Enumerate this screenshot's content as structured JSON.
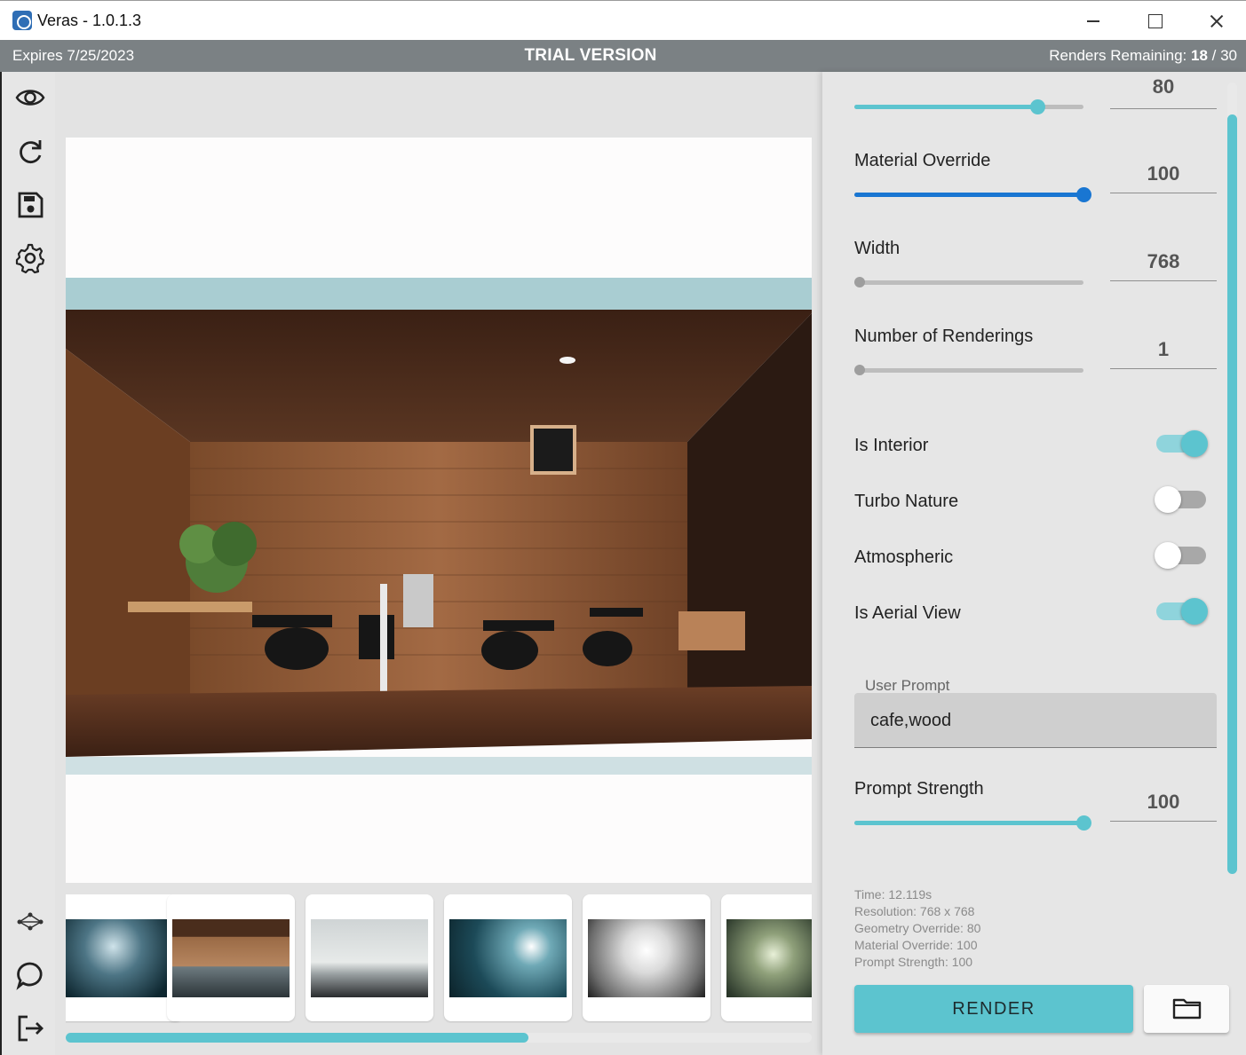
{
  "window": {
    "title": "Veras - 1.0.1.3"
  },
  "banner": {
    "expires": "Expires 7/25/2023",
    "trial": "TRIAL VERSION",
    "renders_label": "Renders Remaining:",
    "renders_used": "18",
    "renders_total": "/ 30"
  },
  "sidebar": {
    "top_icons": [
      "eye-icon",
      "refresh-icon",
      "save-icon",
      "gear-icon"
    ],
    "bottom_icons": [
      "network-icon",
      "chat-icon",
      "logout-icon"
    ]
  },
  "viewer": {
    "image_description_visible": false,
    "thumbnails_count": 6,
    "scroll_fraction": 0.62
  },
  "panel": {
    "geometry_override": {
      "value": "80",
      "fraction": 0.8
    },
    "material_override": {
      "label": "Material Override",
      "value": "100",
      "fraction": 1.0
    },
    "width": {
      "label": "Width",
      "value": "768",
      "fraction": 0.0
    },
    "num_renderings": {
      "label": "Number of Renderings",
      "value": "1",
      "fraction": 0.0
    },
    "toggles": [
      {
        "label": "Is Interior",
        "on": true
      },
      {
        "label": "Turbo Nature",
        "on": false
      },
      {
        "label": "Atmospheric",
        "on": false
      },
      {
        "label": "Is Aerial View",
        "on": true
      }
    ],
    "user_prompt": {
      "label": "User Prompt",
      "value": "cafe,wood"
    },
    "prompt_strength": {
      "label": "Prompt Strength",
      "value": "100",
      "fraction": 1.0
    },
    "stats": {
      "time": "Time: 12.119s",
      "resolution": "Resolution: 768 x 768",
      "geometry": "Geometry Override: 80",
      "material": "Material Override: 100",
      "prompt": "Prompt Strength: 100"
    },
    "render_label": "RENDER"
  },
  "colors": {
    "accent": "#5cc4cf",
    "active_slider": "#1976d2",
    "banner": "#7b8184"
  }
}
